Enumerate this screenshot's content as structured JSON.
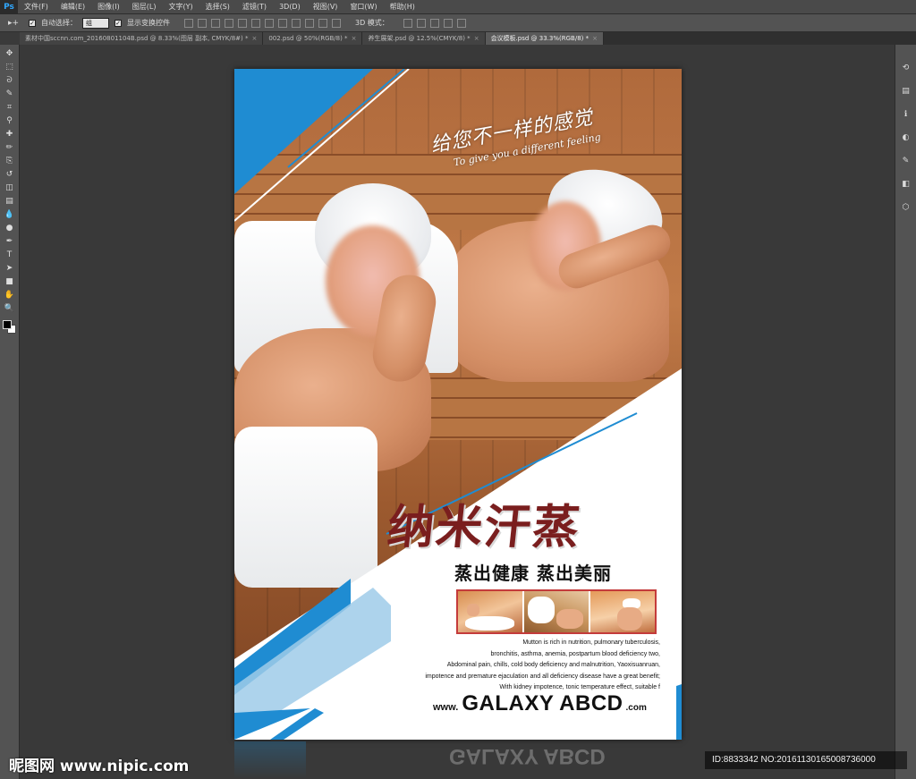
{
  "app": {
    "logo": "Ps",
    "menu": [
      "文件(F)",
      "编辑(E)",
      "图像(I)",
      "图层(L)",
      "文字(Y)",
      "选择(S)",
      "滤镜(T)",
      "3D(D)",
      "视图(V)",
      "窗口(W)",
      "帮助(H)"
    ]
  },
  "options_bar": {
    "tool_glyph": "▸+",
    "auto_select_checked": "✓",
    "auto_select_label": "自动选择：",
    "auto_select_value": "组",
    "show_transform_checked": "✓",
    "show_transform_label": "显示变换控件",
    "mode_3d_label": "3D 模式："
  },
  "tabs": [
    {
      "label": "素材中国sccnn.com_20160801104B.psd @ 8.33%(图层 副本, CMYK/8#) *",
      "active": false
    },
    {
      "label": "002.psd @ 50%(RGB/8) *",
      "active": false
    },
    {
      "label": "养生展架.psd @ 12.5%(CMYK/8) *",
      "active": false
    },
    {
      "label": "会议模板.psd @ 33.3%(RGB/8) *",
      "active": true
    }
  ],
  "tab_close": "×",
  "toolbar_icons": [
    "move-icon",
    "marquee-icon",
    "lasso-icon",
    "quick-select-icon",
    "crop-icon",
    "eyedropper-icon",
    "healing-icon",
    "brush-icon",
    "stamp-icon",
    "history-brush-icon",
    "eraser-icon",
    "gradient-icon",
    "blur-icon",
    "dodge-icon",
    "pen-icon",
    "type-icon",
    "path-select-icon",
    "shape-icon",
    "hand-icon",
    "zoom-icon"
  ],
  "toolbar_glyphs": [
    "✥",
    "⬚",
    "ᘐ",
    "✎",
    "⌗",
    "⚲",
    "✚",
    "✏",
    "⎘",
    "↺",
    "◫",
    "▤",
    "💧",
    "●",
    "✒",
    "T",
    "➤",
    "■",
    "✋",
    "🔍"
  ],
  "right_panel_icons": [
    "history-icon",
    "layers-icon",
    "properties-icon",
    "channels-icon",
    "paths-icon",
    "adjustments-icon",
    "styles-icon"
  ],
  "right_panel_glyphs": [
    "⟲",
    "▤",
    "ℹ",
    "◐",
    "✎",
    "◧",
    "⬡"
  ],
  "poster": {
    "slogan_cn": "给您不一样的感觉",
    "slogan_en": "To give you a different feeling",
    "title": "纳米汗蒸",
    "subtitle": "蒸出健康  蒸出美丽",
    "description_lines": [
      "Mutton is rich in nutrition, pulmonary tuberculosis,",
      "bronchitis, asthma, anemia, postpartum blood deficiency two,",
      "Abdominal pain, chills, cold body deficiency and malnutrition, Yaoxisuanruan,",
      "impotence and premature ejaculation and all deficiency disease have a great benefit;",
      "With kidney impotence, tonic temperature effect, suitable f"
    ],
    "url_www": "www.",
    "url_brand": "GALAXY ABCD",
    "url_com": ".com"
  },
  "reflection_text": "GALAXY ABCD",
  "watermark": {
    "left": "昵图网 www.nipic.com",
    "right": "ID:8833342 NO:20161130165008736000"
  },
  "colors": {
    "accent_blue": "#1f8cd2",
    "title_red": "#7a1e1e",
    "strip_border": "#c43b3b"
  }
}
